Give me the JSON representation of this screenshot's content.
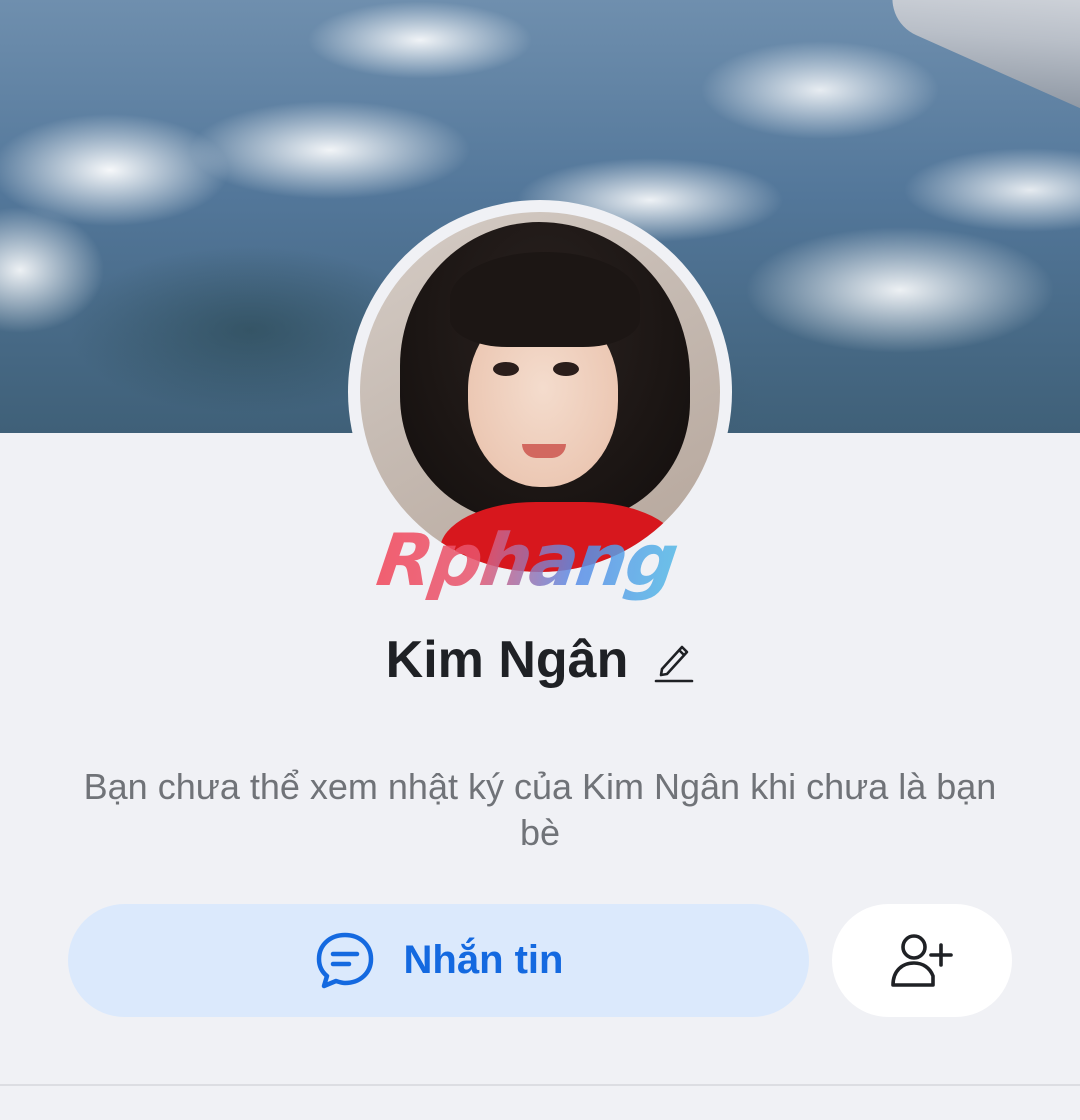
{
  "profile": {
    "name": "Kim Ngân",
    "restriction_message": "Bạn chưa thể xem nhật ký của Kim Ngân khi chưa là bạn bè"
  },
  "watermark": {
    "text": "Rphang"
  },
  "actions": {
    "message_label": "Nhắn tin",
    "message_icon": "chat-bubble-icon",
    "add_friend_icon": "add-friend-icon",
    "edit_icon": "pencil-icon"
  },
  "colors": {
    "accent": "#1469e0",
    "message_button_bg": "#dbe9fc",
    "page_bg": "#f0f1f5",
    "name_text": "#1f2125",
    "secondary_text": "#707378"
  }
}
